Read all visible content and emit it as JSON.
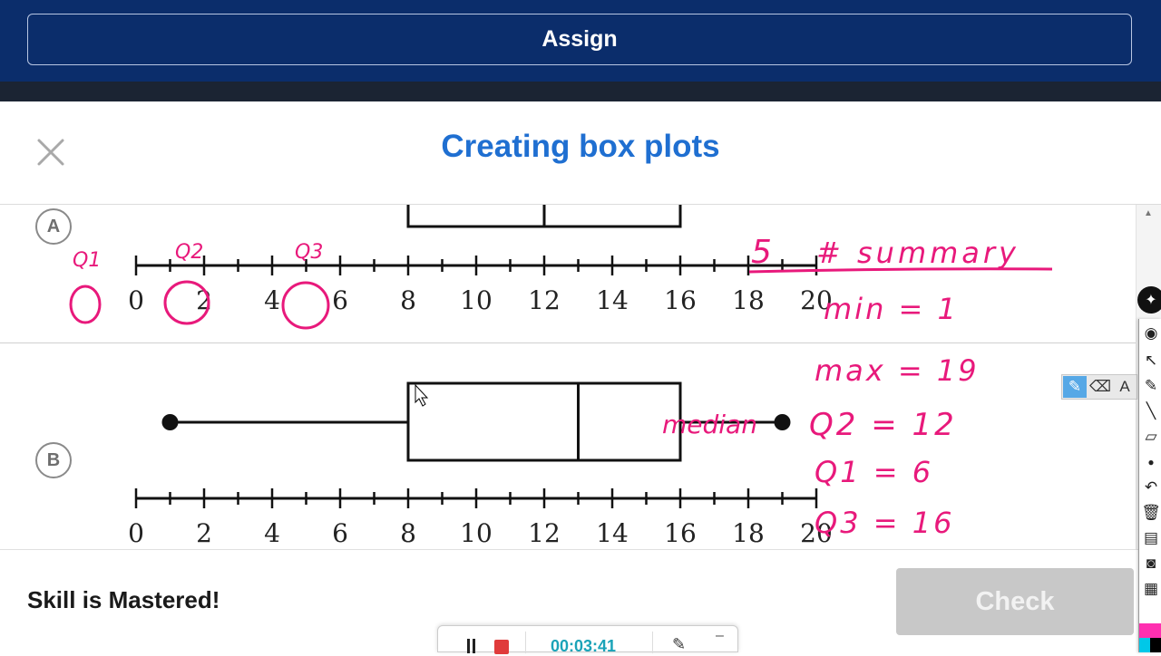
{
  "topbar": {
    "assign_label": "Assign"
  },
  "header": {
    "title": "Creating box plots",
    "close_icon": "close-icon"
  },
  "choices": [
    {
      "badge": "A",
      "axis": {
        "min": 0,
        "max": 20,
        "tick_step": 1,
        "label_step": 2,
        "labels": [
          "0",
          "2",
          "4",
          "6",
          "8",
          "10",
          "12",
          "14",
          "16",
          "18",
          "20"
        ]
      },
      "box": {
        "q1": 8,
        "median": 12,
        "q3": 16
      }
    },
    {
      "badge": "B",
      "axis": {
        "min": 0,
        "max": 20,
        "tick_step": 1,
        "label_step": 2,
        "labels": [
          "0",
          "2",
          "4",
          "6",
          "8",
          "10",
          "12",
          "14",
          "16",
          "18",
          "20"
        ]
      },
      "box": {
        "min": 1,
        "q1": 8,
        "median": 13,
        "q3": 16,
        "max": 19
      }
    }
  ],
  "annotations": {
    "q1": "Q1",
    "q2": "Q2",
    "q3": "Q3",
    "summary_title_num": "5",
    "summary_title": "# summary",
    "min_line": "min = 1",
    "max_line": "max = 19",
    "median_word": "median",
    "q2_line": "Q2 = 12",
    "q1_line": "Q1 = 6",
    "q3_line": "Q3 = 16",
    "color": "#e8197b"
  },
  "footer": {
    "status": "Skill is Mastered!",
    "check_label": "Check"
  },
  "recorder": {
    "time": "00:03:41"
  },
  "colors": {
    "topbar": "#0b2d6b",
    "title": "#1f6fd1",
    "check_disabled": "#c8c8c8",
    "ink": "#e8197b"
  }
}
